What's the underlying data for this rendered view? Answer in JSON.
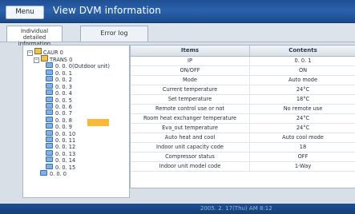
{
  "window": {
    "menu_label": "Menu",
    "title": "View DVM information"
  },
  "tabs": [
    {
      "label": "Individual detailed information",
      "line1": "Individual",
      "line2": "detailed information",
      "active": true
    },
    {
      "label": "Error log",
      "active": false
    }
  ],
  "tree": {
    "root": "CAUR 0",
    "group": "TRANS 0",
    "outdoor": "0. 0. 0(Outdoor unit)",
    "units": [
      "0. 0. 1",
      "0. 0. 2",
      "0. 0. 3",
      "0. 0. 4",
      "0. 0. 5",
      "0. 0. 6",
      "0. 0. 7",
      "0. 0. 8",
      "0. 0. 9",
      "0. 0. 10",
      "0. 0. 11",
      "0. 0. 12",
      "0. 0. 13",
      "0. 0. 14",
      "0. 0. 15"
    ],
    "last": "0. 0. 0",
    "selected": "0. 0. 1"
  },
  "table": {
    "headers": {
      "items": "Items",
      "contents": "Contents"
    },
    "rows": [
      {
        "item": "IP",
        "value": "0. 0. 1"
      },
      {
        "item": "ON/OFF",
        "value": "ON"
      },
      {
        "item": "Mode",
        "value": "Auto mode"
      },
      {
        "item": "Current temperature",
        "value": "24°C"
      },
      {
        "item": "Set temperature",
        "value": "18°C"
      },
      {
        "item": "Remote control use or not",
        "value": "No remote use"
      },
      {
        "item": "Room heat exchanger temperature",
        "value": "24°C"
      },
      {
        "item": "Eva_out temperature",
        "value": "24°C"
      },
      {
        "item": "Auto heat and cool",
        "value": "Auto cool mode"
      },
      {
        "item": "Indoor unit capacity code",
        "value": "18"
      },
      {
        "item": "Compressor status",
        "value": "OFF"
      },
      {
        "item": "Indoor unit model code",
        "value": "1-Way"
      }
    ]
  },
  "status": {
    "text": "2005. 2. 17(Thu) AM 8:12"
  },
  "colors": {
    "titlebar": "#2b62ad",
    "selection": "#f9b83a",
    "statusbar": "#1d4f93"
  }
}
